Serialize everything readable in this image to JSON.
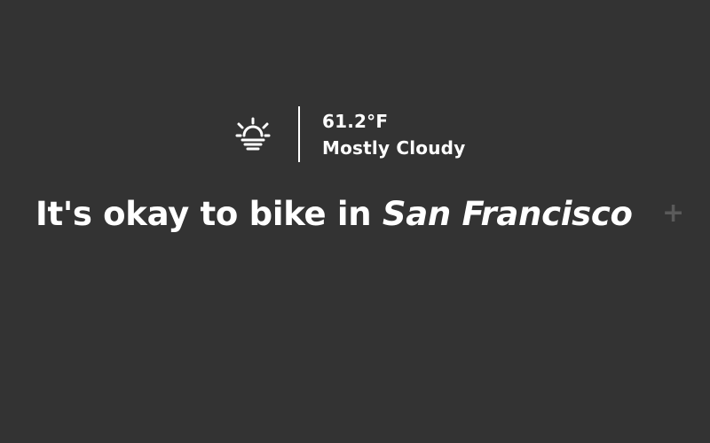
{
  "weather": {
    "icon": "sunrise-cloudy-icon",
    "temperature": "61.2°F",
    "condition": "Mostly Cloudy"
  },
  "headline": {
    "prefix": "It's okay to bike in ",
    "city": "San Francisco",
    "add_label": "+"
  },
  "colors": {
    "background": "#333333",
    "text": "#ffffff",
    "add_button": "#5a5a5a"
  }
}
